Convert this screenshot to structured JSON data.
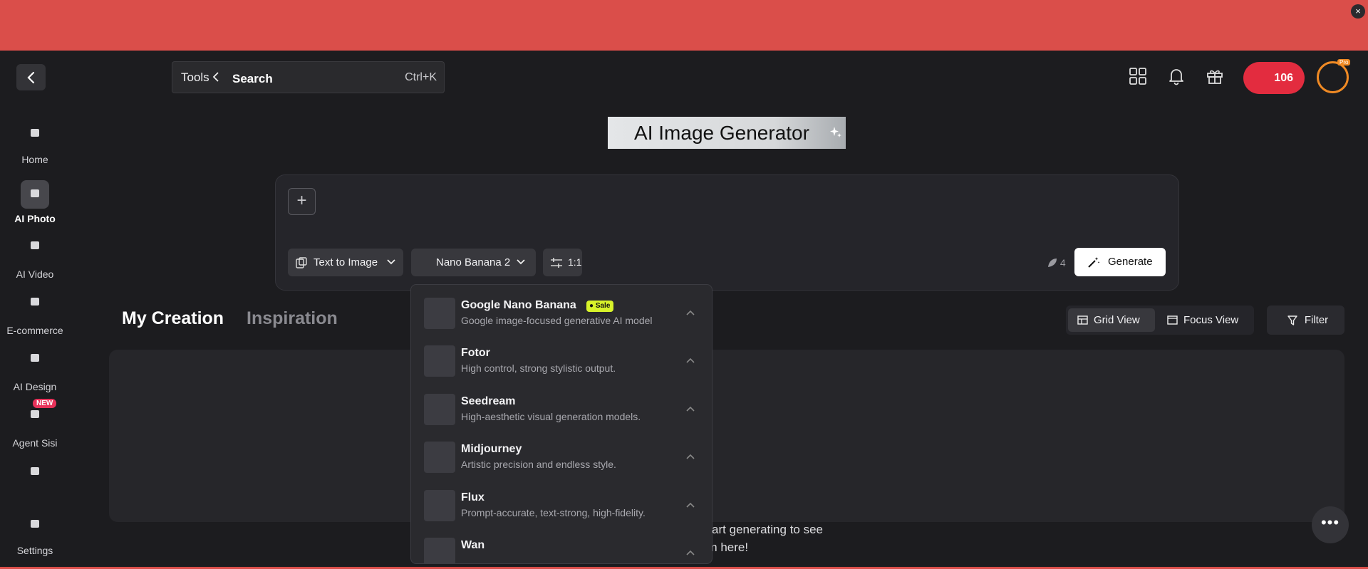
{
  "banner": {
    "close_label": "×"
  },
  "search": {
    "tools_label": "Tools",
    "search_label": "Search",
    "shortcut": "Ctrl+K"
  },
  "sidebar": {
    "items": [
      {
        "label": "Home",
        "icon": "home-icon",
        "active": false
      },
      {
        "label": "AI Photo",
        "icon": "ai-photo-icon",
        "active": true
      },
      {
        "label": "AI Video",
        "icon": "ai-video-icon",
        "active": false
      },
      {
        "label": "E-commerce",
        "icon": "ecommerce-icon",
        "active": false
      },
      {
        "label": "AI Design",
        "icon": "ai-design-icon",
        "active": false
      },
      {
        "label": "Agent Sisi",
        "icon": "agent-icon",
        "active": false,
        "badge": "NEW"
      },
      {
        "label": "",
        "icon": "brush-icon",
        "active": false
      },
      {
        "label": "Settings",
        "icon": "settings-icon",
        "active": false
      }
    ]
  },
  "header": {
    "credits": "106",
    "pro_badge": "Pro"
  },
  "page": {
    "title": "AI Image Generator"
  },
  "prompt": {
    "mode_label": "Text to Image",
    "model_label": "Nano Banana 2",
    "ratio_label": "1:1",
    "cost": "4",
    "generate_label": "Generate"
  },
  "tabs": {
    "my_creation": "My Creation",
    "inspiration": "Inspiration"
  },
  "views": {
    "grid": "Grid View",
    "focus": "Focus View",
    "filter": "Filter"
  },
  "empty": {
    "line1": "Start generating to see",
    "line2": "em here!"
  },
  "dropdown": {
    "models": [
      {
        "name": "Google Nano Banana",
        "desc": "Google image-focused generative AI model",
        "badge": "Sale"
      },
      {
        "name": "Fotor",
        "desc": "High control, strong stylistic output."
      },
      {
        "name": "Seedream",
        "desc": "High-aesthetic visual generation models."
      },
      {
        "name": "Midjourney",
        "desc": "Artistic precision and endless style."
      },
      {
        "name": "Flux",
        "desc": "Prompt-accurate, text-strong, high-fidelity."
      },
      {
        "name": "Wan",
        "desc": ""
      }
    ]
  },
  "colors": {
    "brand_red": "#e32c3f",
    "banner": "#da4e4a",
    "sale": "#d8f32a",
    "avatar_ring": "#f08a24"
  }
}
